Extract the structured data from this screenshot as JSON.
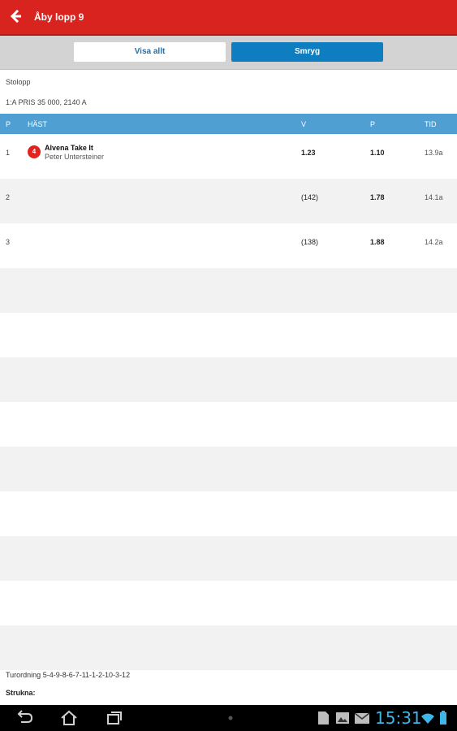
{
  "app": {
    "title": "Åby lopp 9"
  },
  "segments": {
    "show_all": "Visa allt",
    "small": "Smryg"
  },
  "race": {
    "type": "Stolopp",
    "prize": "1:A PRIS 35 000, 2140 A"
  },
  "table": {
    "headers": {
      "p": "P",
      "horse": "HÄST",
      "v": "V",
      "p2": "P",
      "time": "TID"
    },
    "rows": [
      {
        "p": "1",
        "number": "4",
        "horse": "Alvena Take It",
        "driver": "Peter Untersteiner",
        "v": "1.23",
        "p2": "1.10",
        "time": "13.9a"
      },
      {
        "p": "2",
        "number": "",
        "horse": "",
        "driver": "",
        "v": "(142)",
        "p2": "1.78",
        "time": "14.1a"
      },
      {
        "p": "3",
        "number": "",
        "horse": "",
        "driver": "",
        "v": "(138)",
        "p2": "1.88",
        "time": "14.2a"
      }
    ]
  },
  "footer": {
    "order": "Turordning 5-4-9-8-6-7-11-1-2-10-3-12",
    "scratched": "Strukna:"
  },
  "statusbar": {
    "time": "15:31"
  },
  "colors": {
    "header_red": "#d8231e",
    "table_blue": "#4f9fd3",
    "active_blue": "#0e7ec1",
    "clock_blue": "#3fb6e8"
  }
}
